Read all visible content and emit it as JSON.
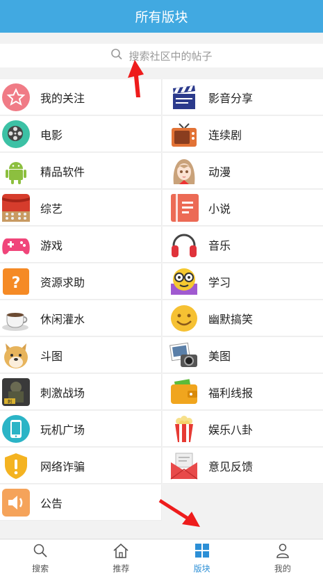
{
  "header": {
    "title": "所有版块"
  },
  "search": {
    "placeholder": "搜索社区中的帖子"
  },
  "boards": [
    {
      "label": "我的关注",
      "icon": "star-icon",
      "color": "#f07b86"
    },
    {
      "label": "影音分享",
      "icon": "clapperboard-icon",
      "color": "#2b3a8c"
    },
    {
      "label": "电影",
      "icon": "film-reel-icon",
      "color": "#3cc1a5"
    },
    {
      "label": "连续剧",
      "icon": "tv-icon",
      "color": "#e27235"
    },
    {
      "label": "精品软件",
      "icon": "android-icon",
      "color": "#8cbf3f"
    },
    {
      "label": "动漫",
      "icon": "anime-girl-icon",
      "color": "#c9a27a"
    },
    {
      "label": "综艺",
      "icon": "stage-icon",
      "color": "#d63c2c"
    },
    {
      "label": "小说",
      "icon": "book-icon",
      "color": "#ec6a55"
    },
    {
      "label": "游戏",
      "icon": "gamepad-icon",
      "color": "#f0457a"
    },
    {
      "label": "音乐",
      "icon": "headphones-icon",
      "color": "#e0333b"
    },
    {
      "label": "资源求助",
      "icon": "question-icon",
      "color": "#f58a25"
    },
    {
      "label": "学习",
      "icon": "nerd-emoji-icon",
      "color": "#f5c930"
    },
    {
      "label": "休闲灌水",
      "icon": "coffee-cup-icon",
      "color": "#6b5a4a"
    },
    {
      "label": "幽默搞笑",
      "icon": "smile-emoji-icon",
      "color": "#f6c133"
    },
    {
      "label": "斗图",
      "icon": "doge-icon",
      "color": "#e7b45c"
    },
    {
      "label": "美图",
      "icon": "photos-icon",
      "color": "#5a7fa8"
    },
    {
      "label": "刺激战场",
      "icon": "pubg-icon",
      "color": "#3a3a3a"
    },
    {
      "label": "福利线报",
      "icon": "wallet-icon",
      "color": "#f0a51e"
    },
    {
      "label": "玩机广场",
      "icon": "phone-icon",
      "color": "#2bb4c6"
    },
    {
      "label": "娱乐八卦",
      "icon": "popcorn-icon",
      "color": "#e63a33"
    },
    {
      "label": "网络诈骗",
      "icon": "shield-icon",
      "color": "#f4b321"
    },
    {
      "label": "意见反馈",
      "icon": "mail-icon",
      "color": "#e84a4a"
    },
    {
      "label": "公告",
      "icon": "speaker-icon",
      "color": "#f5a35a"
    }
  ],
  "tabs": [
    {
      "label": "搜索",
      "icon": "search-icon",
      "active": false
    },
    {
      "label": "推荐",
      "icon": "home-icon",
      "active": false
    },
    {
      "label": "版块",
      "icon": "grid-icon",
      "active": true
    },
    {
      "label": "我的",
      "icon": "person-icon",
      "active": false
    }
  ],
  "colors": {
    "header_bg": "#41a9e1",
    "tab_active": "#2c8fd6",
    "annotation_arrow": "#ee1c1c"
  }
}
